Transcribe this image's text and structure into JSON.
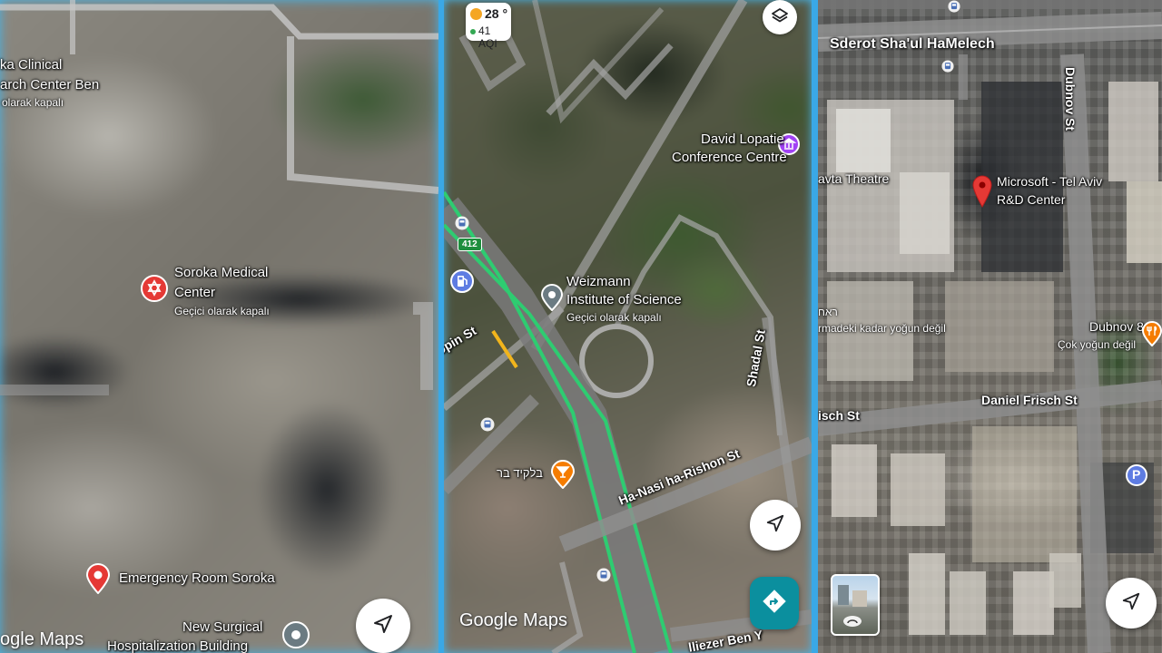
{
  "panel1": {
    "labels": {
      "clinical_line1": "ka Clinical",
      "clinical_line2": "arch Center Ben",
      "clinical_status": "olarak kapalı",
      "soroka_line1": "Soroka Medical",
      "soroka_line2": "Center",
      "soroka_status": "Geçici olarak kapalı",
      "emergency": "Emergency Room Soroka",
      "surgical_line1": "New Surgical",
      "surgical_line2": "Hospitalization Building",
      "watermark": "ogle Maps"
    },
    "pins": {
      "soroka_color": "#e53935",
      "emergency_color": "#e53935"
    },
    "icons": {
      "soroka_pin": "star-of-david-icon",
      "emergency_pin": "map-pin-icon",
      "surgical_pin": "place-pin-icon",
      "location_button": "navigation-arrow-icon"
    }
  },
  "panel2": {
    "weather": {
      "temperature": "28 °",
      "aqi": "41 AQI"
    },
    "labels": {
      "lopatie_line1": "David Lopatie",
      "lopatie_line2": "Conference Centre",
      "weizmann_line1": "Weizmann",
      "weizmann_line2": "Institute of Science",
      "weizmann_status": "Geçici olarak kapalı",
      "pub_name": "בלקיד בר",
      "watermark": "Google Maps"
    },
    "streets": {
      "chopin": "opin St",
      "shadal": "Shadal St",
      "hanasi": "Ha-Nasi ha-Rishon St",
      "eliezer": "lliezer Ben Y"
    },
    "highway_badge": "412",
    "colors": {
      "traffic_green": "#2ecc71",
      "traffic_yellow": "#f2b51c",
      "pub_pin": "#f57c00",
      "lopatie_pin": "#a142f4",
      "directions_button": "#0b8f9e"
    },
    "icons": {
      "layers": "layers-icon",
      "lopatie_pin": "landmark-icon",
      "weizmann_pin": "place-pin-icon",
      "pub_pin": "cocktail-icon",
      "gas_pin": "gas-station-icon",
      "location_button": "navigation-arrow-icon",
      "directions_button": "directions-icon",
      "bus_stop": "bus-icon",
      "sun": "sun-icon"
    }
  },
  "panel3": {
    "streets": {
      "shaul": "Sderot Sha'ul HaMelech",
      "dubnov": "Dubnov St",
      "daniel": "Daniel Frisch St",
      "frisch_left": "isch St"
    },
    "labels": {
      "theatre": "avta Theatre",
      "microsoft_line1": "Microsoft - Tel Aviv",
      "microsoft_line2": "R&D Center",
      "hebrew_label": "ראח",
      "busy_left": "rmadeki kadar yoğun değil",
      "dubnov8": "Dubnov 8",
      "dubnov8_status": "Çok yoğun değil",
      "parking_letter": "P"
    },
    "colors": {
      "microsoft_pin": "#e53935",
      "dubnov8_pin": "#f57c00",
      "parking_pin": "#5e7ce2"
    },
    "icons": {
      "microsoft_pin": "map-pin-icon",
      "dubnov8_pin": "restaurant-icon",
      "parking_pin": "parking-icon",
      "streetview": "street-view-icon",
      "location_button": "navigation-arrow-icon",
      "bus_stop": "bus-icon"
    }
  }
}
